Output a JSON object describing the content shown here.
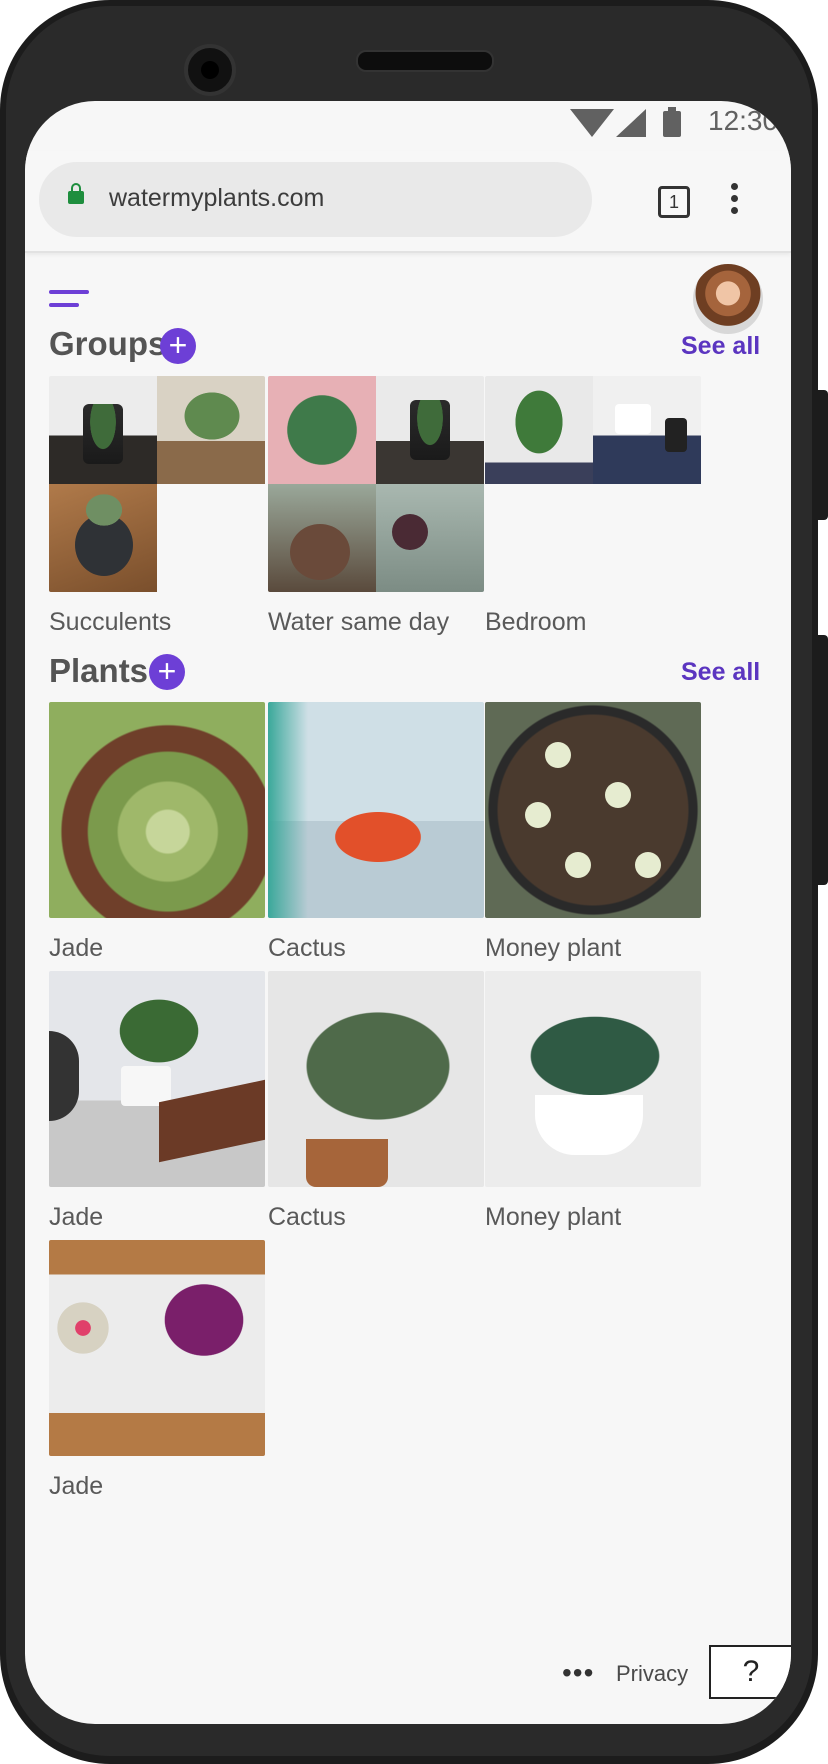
{
  "status_bar": {
    "time": "12:30"
  },
  "browser": {
    "url": "watermyplants.com",
    "tab_count": "1"
  },
  "groups": {
    "title": "Groups",
    "add_label": "+",
    "see_all": "See all",
    "items": [
      {
        "label": "Succulents"
      },
      {
        "label": "Water same day"
      },
      {
        "label": "Bedroom"
      }
    ]
  },
  "plants": {
    "title": "Plants",
    "add_label": "+",
    "see_all": "See all",
    "items": [
      {
        "label": "Jade"
      },
      {
        "label": "Cactus"
      },
      {
        "label": "Money plant"
      },
      {
        "label": "Jade"
      },
      {
        "label": "Cactus"
      },
      {
        "label": "Money plant"
      },
      {
        "label": "Jade"
      }
    ]
  },
  "footer": {
    "more": "•••",
    "privacy": "Privacy",
    "help": "?"
  },
  "colors": {
    "accent": "#6d3fd6",
    "link": "#5b35c0",
    "background": "#f7f7f7"
  }
}
